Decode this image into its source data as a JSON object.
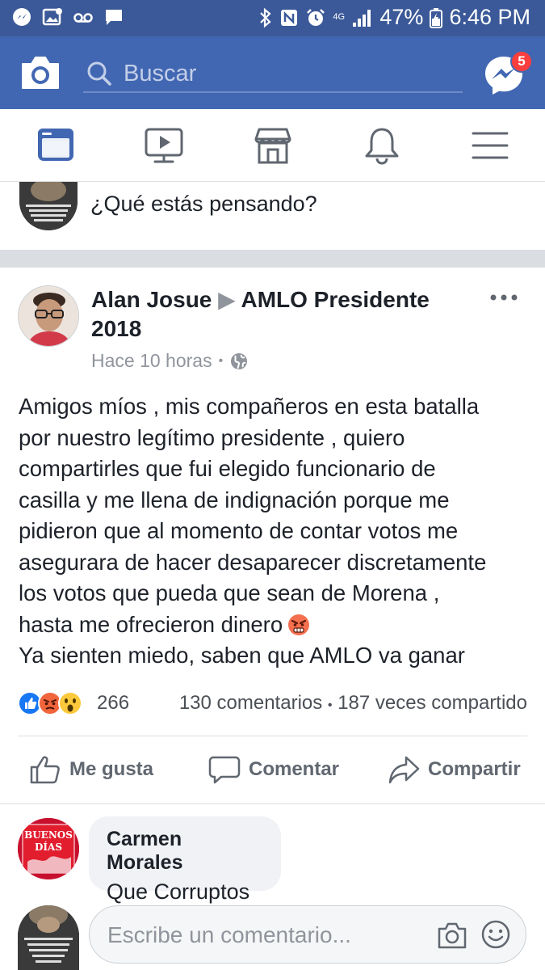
{
  "status_bar": {
    "battery": "47%",
    "time": "6:46 PM",
    "network": "4G"
  },
  "header": {
    "search_placeholder": "Buscar",
    "messenger_badge": "5"
  },
  "composer": {
    "prompt": "¿Qué estás pensando?"
  },
  "post": {
    "author": "Alan Josue",
    "target": "AMLO Presidente 2018",
    "time": "Hace 10 horas",
    "privacy_icon": "globe-icon",
    "body_lines": [
      "Amigos míos , mis compañeros en esta batalla",
      "por nuestro legítimo presidente , quiero",
      "compartirles que fui elegido funcionario de",
      "casilla y me llena de indignación porque me",
      "pidieron que al momento de contar votos me",
      "asegurara de hacer desaparecer discretamente",
      "los votos que pueda que sean de Morena ,",
      "hasta me ofrecieron dinero"
    ],
    "body_last_line": "Ya sienten miedo, saben que AMLO va ganar",
    "reaction_count": "266",
    "comments_count": "130 comentarios",
    "shares_count": "187 veces compartido",
    "separator": "•"
  },
  "actions": {
    "like": "Me gusta",
    "comment": "Comentar",
    "share": "Compartir"
  },
  "comment": {
    "name": "Carmen Morales",
    "text": "Que Corruptos",
    "avatar_text": "BUENOS DÍAS"
  },
  "comment_input": {
    "placeholder": "Escribe un comentario..."
  },
  "colors": {
    "brand": "#4267b2",
    "status_bar": "#3b5998",
    "badge": "#fa3e3e",
    "like_blue": "#1877f2"
  }
}
